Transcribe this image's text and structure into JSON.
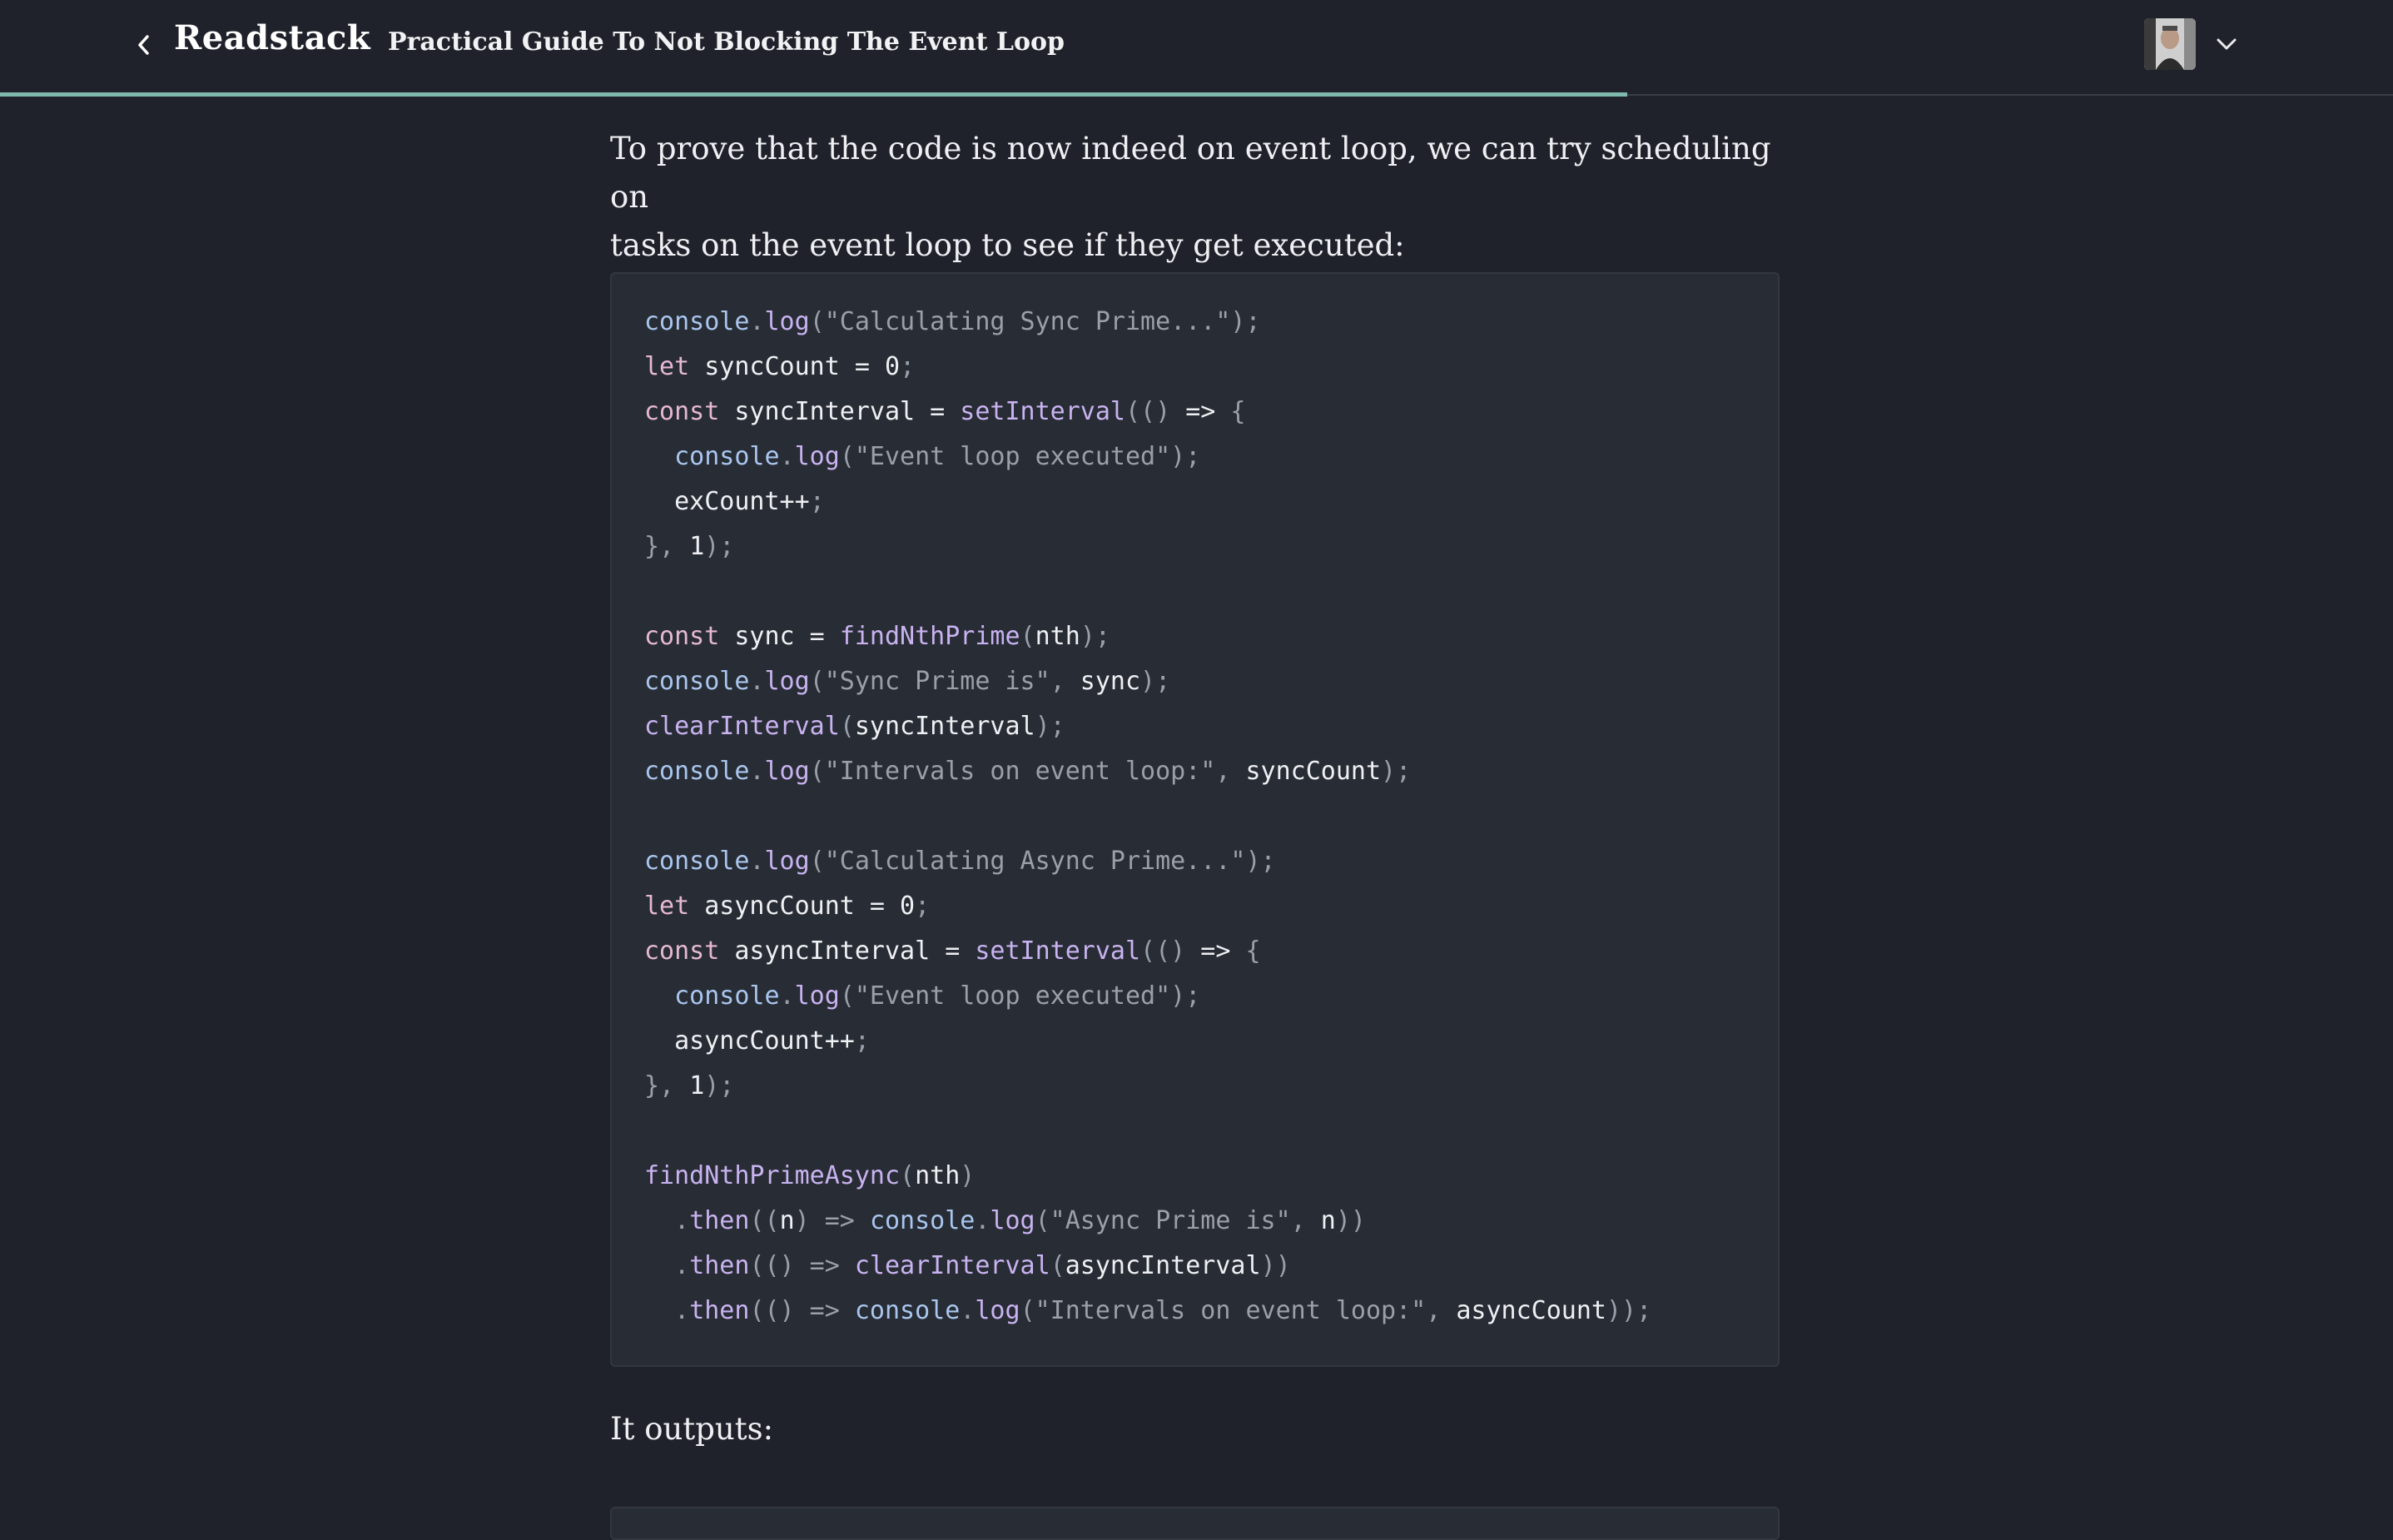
{
  "header": {
    "brand": "Readstack",
    "document_title": "Practical Guide To Not Blocking The Event Loop",
    "reading_progress_percent": 68
  },
  "article": {
    "intro_line1": "To prove that the code is now indeed on event loop, we can try scheduling on",
    "intro_line2": "tasks on the event loop to see if they get executed:",
    "outputs_label": "It outputs:"
  },
  "code": {
    "line1": {
      "a": "console",
      "b": ".",
      "c": "log",
      "d": "(\"Calculating Sync Prime...\");"
    },
    "line2": {
      "a": "let",
      "b": " syncCount = 0",
      "c": ";"
    },
    "line3": {
      "a": "const",
      "b": " syncInterval = ",
      "c": "setInterval",
      "d": "(() ",
      "e": "=>",
      "f": " {"
    },
    "line4": {
      "a": "  console",
      "b": ".",
      "c": "log",
      "d": "(\"Event loop executed\");"
    },
    "line5": {
      "a": "  exCount++",
      "b": ";"
    },
    "line6": {
      "a": "}, ",
      "b": "1",
      "c": ");"
    },
    "line7": {
      "a": "const",
      "b": " sync = ",
      "c": "findNthPrime",
      "d": "(",
      "e": "nth",
      "f": ");"
    },
    "line8": {
      "a": "console",
      "b": ".",
      "c": "log",
      "d": "(\"Sync Prime is\", ",
      "e": "sync",
      "f": ");"
    },
    "line9": {
      "a": "clearInterval",
      "b": "(",
      "c": "syncInterval",
      "d": ");"
    },
    "line10": {
      "a": "console",
      "b": ".",
      "c": "log",
      "d": "(\"Intervals on event loop:\", ",
      "e": "syncCount",
      "f": ");"
    },
    "line11": {
      "a": "console",
      "b": ".",
      "c": "log",
      "d": "(\"Calculating Async Prime...\");"
    },
    "line12": {
      "a": "let",
      "b": " asyncCount = 0",
      "c": ";"
    },
    "line13": {
      "a": "const",
      "b": " asyncInterval = ",
      "c": "setInterval",
      "d": "(() ",
      "e": "=>",
      "f": " {"
    },
    "line14": {
      "a": "  console",
      "b": ".",
      "c": "log",
      "d": "(\"Event loop executed\");"
    },
    "line15": {
      "a": "  asyncCount++",
      "b": ";"
    },
    "line16": {
      "a": "}, ",
      "b": "1",
      "c": ");"
    },
    "line17": {
      "a": "findNthPrimeAsync",
      "b": "(",
      "c": "nth",
      "d": ")"
    },
    "line18": {
      "a": "  .",
      "b": "then",
      "c": "((",
      "d": "n",
      "e": ") => ",
      "f": "console",
      "g": ".",
      "h": "log",
      "i": "(\"Async Prime is\", ",
      "j": "n",
      "k": "))"
    },
    "line19": {
      "a": "  .",
      "b": "then",
      "c": "(() => ",
      "d": "clearInterval",
      "e": "(",
      "f": "asyncInterval",
      "g": "))"
    },
    "line20": {
      "a": "  .",
      "b": "then",
      "c": "(() => ",
      "d": "console",
      "e": ".",
      "f": "log",
      "g": "(\"Intervals on event loop:\", ",
      "h": "asyncCount",
      "i": "));"
    }
  },
  "icons": {
    "back": "chevron-left-icon",
    "menu": "chevron-down-icon",
    "avatar": "user-avatar"
  },
  "colors": {
    "background": "#1f222a",
    "code_background": "#282c34",
    "progress_accent": "#7fb8ad"
  }
}
